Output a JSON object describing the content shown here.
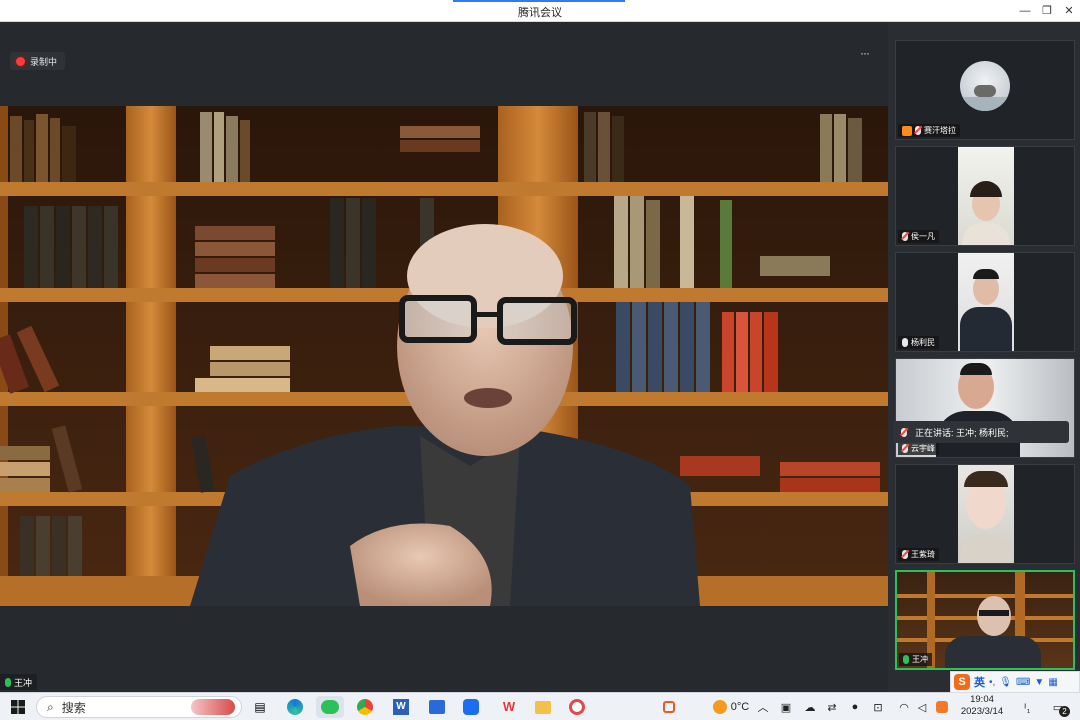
{
  "window": {
    "title": "腾讯会议"
  },
  "stage": {
    "recording_label": "录制中",
    "more_label": "···",
    "speaker_name": "王冲"
  },
  "participants": [
    {
      "name": "赛汗塔拉",
      "host": true
    },
    {
      "name": "侯一凡"
    },
    {
      "name": "杨利民"
    },
    {
      "name": "云宇峰"
    },
    {
      "name": "王紫琦"
    },
    {
      "name": "王冲"
    }
  ],
  "speaking_banner": "正在讲话: 王冲; 杨利民;",
  "taskbar": {
    "search_label": "搜索",
    "temperature": "0°C",
    "ime_label": "英",
    "time": "19:04",
    "date": "2023/3/14",
    "notification_count": "2"
  },
  "colors": {
    "accent": "#2f7bf5",
    "recording": "#ff3b3b",
    "mic_active": "#2ac15a",
    "host_badge": "#ff8a1e"
  }
}
